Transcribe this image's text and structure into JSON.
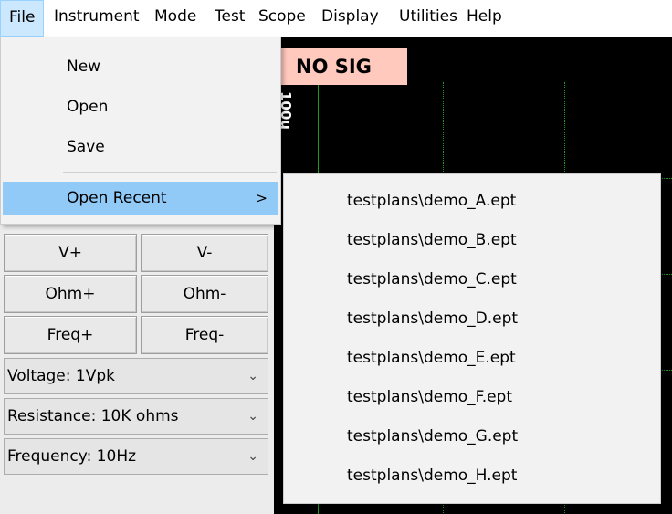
{
  "menubar": {
    "items": [
      "File",
      "Instrument",
      "Mode",
      "Test",
      "Scope",
      "Display",
      "Utilities",
      "Help"
    ]
  },
  "scope": {
    "status": "NO SIG",
    "axis_label": "100u"
  },
  "file_menu": {
    "new": "New",
    "open": "Open",
    "save": "Save",
    "open_recent": "Open Recent",
    "submenu_arrow": ">"
  },
  "recent_files": [
    "testplans\\demo_A.ept",
    "testplans\\demo_B.ept",
    "testplans\\demo_C.ept",
    "testplans\\demo_D.ept",
    "testplans\\demo_E.ept",
    "testplans\\demo_F.ept",
    "testplans\\demo_G.ept",
    "testplans\\demo_H.ept"
  ],
  "controls": {
    "v_plus": "V+",
    "v_minus": "V-",
    "ohm_plus": "Ohm+",
    "ohm_minus": "Ohm-",
    "freq_plus": "Freq+",
    "freq_minus": "Freq-",
    "voltage": "Voltage: 1Vpk",
    "resistance": "Resistance: 10K ohms",
    "frequency": "Frequency: 10Hz"
  },
  "icons": {
    "dropdown": "chevron-down-icon",
    "submenu": "chevron-right-icon"
  },
  "colors": {
    "menu_highlight": "#91c9f7",
    "status_bg": "#ffc9bd",
    "grid": "#1f9a1f"
  }
}
